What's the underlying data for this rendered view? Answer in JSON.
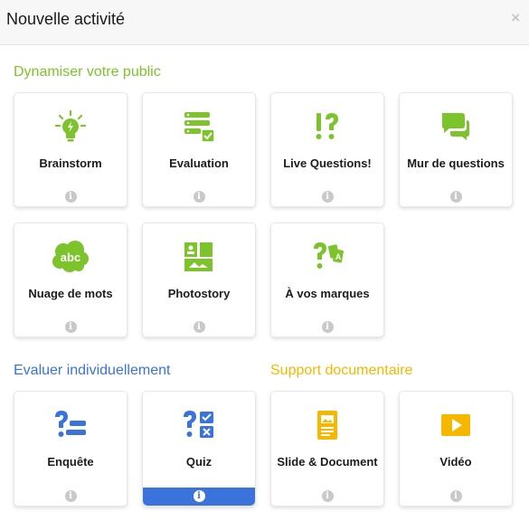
{
  "header": {
    "title": "Nouvelle activité",
    "close_label": "×"
  },
  "colors": {
    "green": "#7cc32c",
    "blue": "#3b73dd",
    "orange": "#f5b700",
    "selected_bar": "#3b73dd"
  },
  "sections": {
    "dynamiser": {
      "title": "Dynamiser votre public"
    },
    "evaluer": {
      "title": "Evaluer individuellement"
    },
    "support": {
      "title": "Support documentaire"
    }
  },
  "cards": {
    "brainstorm": {
      "label": "Brainstorm",
      "icon": "lightbulb-icon"
    },
    "evaluation": {
      "label": "Evaluation",
      "icon": "checklist-icon"
    },
    "live_questions": {
      "label": "Live Questions!",
      "icon": "exclamation-question-icon"
    },
    "mur": {
      "label": "Mur de questions",
      "icon": "chat-bubbles-icon"
    },
    "nuage": {
      "label": "Nuage de mots",
      "icon": "word-cloud-icon"
    },
    "photostory": {
      "label": "Photostory",
      "icon": "photo-grid-icon"
    },
    "vos_marques": {
      "label": "À vos marques",
      "icon": "question-cards-icon"
    },
    "enquete": {
      "label": "Enquête",
      "icon": "survey-icon"
    },
    "quiz": {
      "label": "Quiz",
      "icon": "quiz-icon",
      "selected": true
    },
    "slide": {
      "label": "Slide & Document",
      "icon": "document-icon"
    },
    "video": {
      "label": "Vidéo",
      "icon": "video-play-icon"
    }
  },
  "info_glyph": "i"
}
